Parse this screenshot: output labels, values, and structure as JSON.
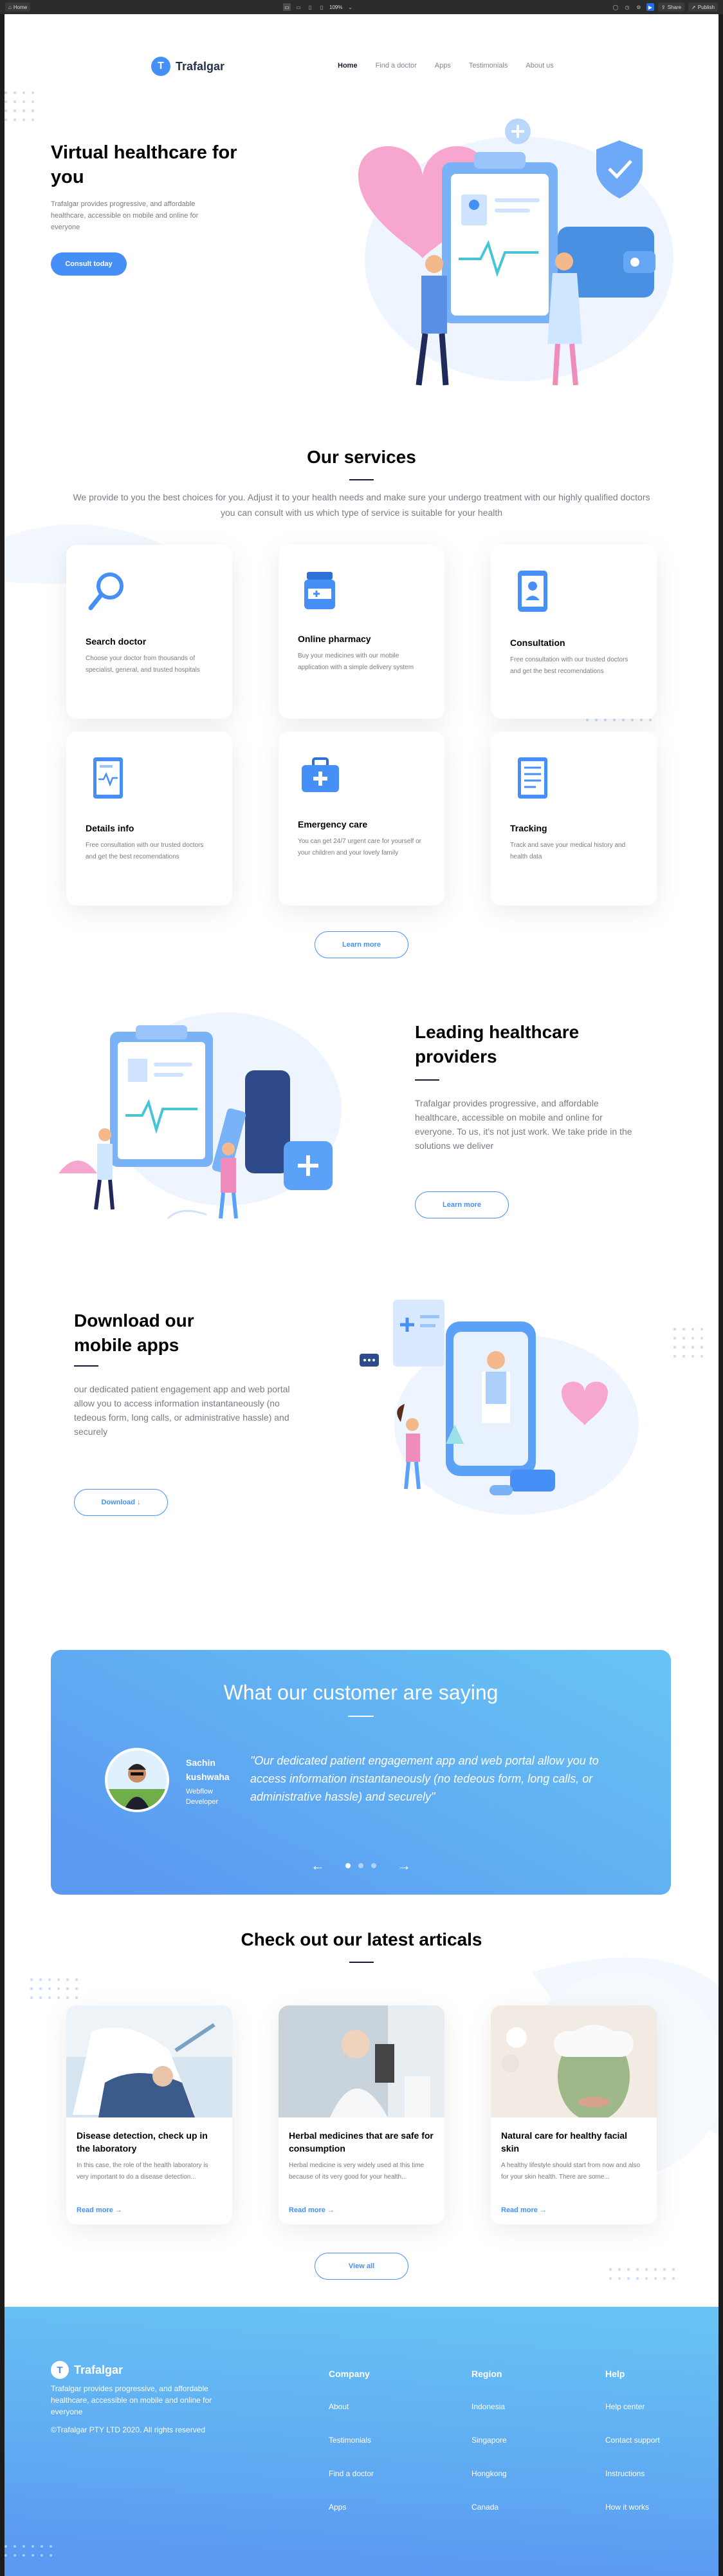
{
  "toolbar": {
    "home_label": "Home",
    "zoom": "109%",
    "share_label": "Share",
    "publish_label": "Publish"
  },
  "nav": {
    "logo_mark": "T",
    "logo_text": "Trafalgar",
    "links": [
      "Home",
      "Find a doctor",
      "Apps",
      "Testimonials",
      "About us"
    ]
  },
  "hero": {
    "title": "Virtual healthcare for you",
    "text": "Trafalgar provides progressive, and affordable healthcare, accessible on mobile and online for everyone",
    "button": "Consult today"
  },
  "services": {
    "title": "Our services",
    "desc": "We provide to you the best choices for you. Adjust it to your health needs and make sure your undergo treatment with our highly qualified doctors you can consult with us which type of service is suitable for your health",
    "cards": [
      {
        "title": "Search doctor",
        "text": "Choose your doctor from thousands of specialist, general, and trusted hospitals",
        "icon": "search-icon"
      },
      {
        "title": "Online pharmacy",
        "text": "Buy your medicines with our mobile application with a simple delivery system",
        "icon": "pill-bottle-icon"
      },
      {
        "title": "Consultation",
        "text": "Free consultation with our trusted doctors and get the best recomendations",
        "icon": "consultation-icon"
      },
      {
        "title": "Details info",
        "text": "Free consultation with our trusted doctors and get the best recomendations",
        "icon": "details-icon"
      },
      {
        "title": "Emergency care",
        "text": "You can get 24/7 urgent care for yourself or your children and your lovely family",
        "icon": "first-aid-kit-icon"
      },
      {
        "title": "Tracking",
        "text": "Track and save your medical history and health data",
        "icon": "tracking-icon"
      }
    ],
    "button": "Learn more"
  },
  "leading": {
    "title": "Leading healthcare providers",
    "text": "Trafalgar provides progressive, and affordable healthcare, accessible on mobile and online for everyone. To us, it's not just work. We take pride in the solutions we deliver",
    "button": "Learn more"
  },
  "download": {
    "title": "Download our mobile apps",
    "text": "our dedicated patient engagement app and web portal allow you to access information instantaneously (no tedeous form, long calls, or administrative hassle) and securely",
    "button": "Download ↓"
  },
  "testimonial": {
    "title": "What our customer are saying",
    "name": "Sachin kushwaha",
    "role": "Webflow Developer",
    "quote": "\"Our dedicated patient engagement app and web portal allow you to access information instantaneously (no tedeous form, long calls, or administrative hassle) and securely\"",
    "prev": "←",
    "next": "→"
  },
  "articles": {
    "title": "Check out our latest articals",
    "items": [
      {
        "title": "Disease detection, check up in the laboratory",
        "text": "In this case, the role of the health laboratory is very important to do a disease detection...",
        "more": "Read more →"
      },
      {
        "title": "Herbal medicines that are safe for consumption",
        "text": "Herbal medicine is very widely used at this time because of its very good for your health...",
        "more": "Read more →"
      },
      {
        "title": "Natural care for healthy facial skin",
        "text": "A healthy lifestyle should start from now and also for your skin health. There are some...",
        "more": "Read more →"
      }
    ],
    "button": "View all"
  },
  "footer": {
    "logo_mark": "T",
    "logo_text": "Trafalgar",
    "desc": "Trafalgar provides progressive, and affordable healthcare, accessible on mobile and online for everyone",
    "copyright": "©Trafalgar PTY LTD 2020. All rights reserved",
    "columns": [
      {
        "heading": "Company",
        "links": [
          "About",
          "Testimonials",
          "Find a doctor",
          "Apps"
        ]
      },
      {
        "heading": "Region",
        "links": [
          "Indonesia",
          "Singapore",
          "Hongkong",
          "Canada"
        ]
      },
      {
        "heading": "Help",
        "links": [
          "Help center",
          "Contact support",
          "Instructions",
          "How it works"
        ]
      }
    ]
  },
  "colors": {
    "primary": "#458ff6",
    "heading": "#000000",
    "body": "#7d7987",
    "gradient_start": "#67c3f3",
    "gradient_end": "#5a98f2"
  }
}
